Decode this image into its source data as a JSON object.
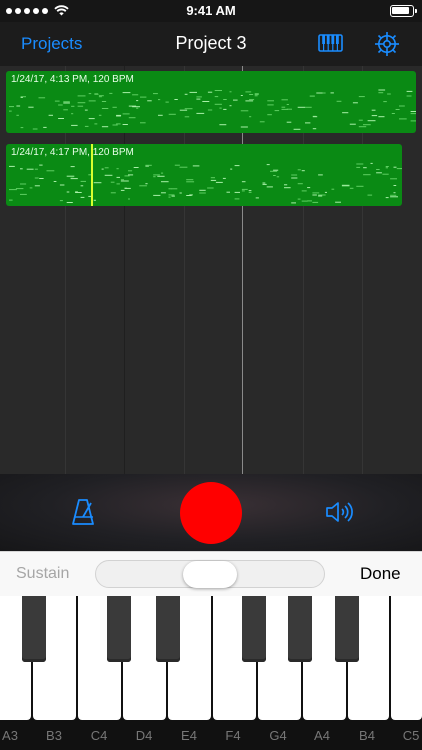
{
  "status_bar": {
    "time": "9:41 AM"
  },
  "nav": {
    "back_label": "Projects",
    "title": "Project 3"
  },
  "tracks": [
    {
      "label": "1/24/17, 4:13 PM, 120 BPM"
    },
    {
      "label": "1/24/17, 4:17 PM, 120 BPM"
    }
  ],
  "keyboard_toolbar": {
    "sustain_label": "Sustain",
    "done_label": "Done",
    "slider_level": 0.5
  },
  "piano": {
    "key_labels": [
      "A3",
      "B3",
      "C4",
      "D4",
      "E4",
      "F4",
      "G4",
      "A4",
      "B4",
      "C5"
    ]
  },
  "colors": {
    "accent": "#1a8cff",
    "record": "#ff0000",
    "region": "#0a8a14",
    "playhead_marker": "#d8ff2e"
  },
  "icons": [
    "keyboard-icon",
    "gear-icon",
    "metronome-icon",
    "speaker-icon"
  ]
}
